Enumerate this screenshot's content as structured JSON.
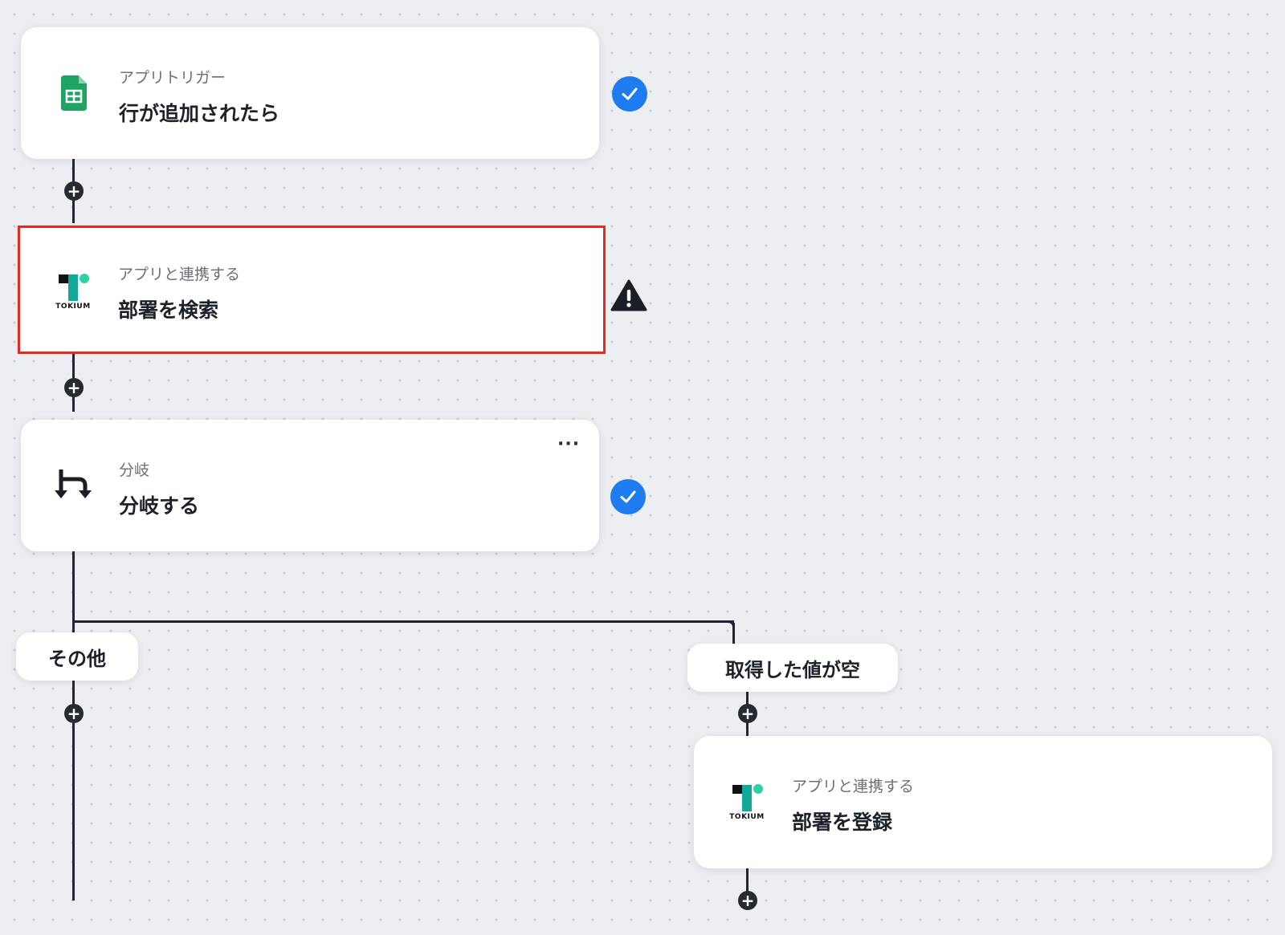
{
  "nodes": {
    "trigger": {
      "subtitle": "アプリトリガー",
      "title": "行が追加されたら",
      "icon": "google-sheets-icon",
      "status": "complete"
    },
    "search": {
      "subtitle": "アプリと連携する",
      "title": "部署を検索",
      "icon": "tokium-icon",
      "status": "warning"
    },
    "branch": {
      "subtitle": "分岐",
      "title": "分岐する",
      "icon": "branch-icon",
      "status": "complete"
    },
    "register": {
      "subtitle": "アプリと連携する",
      "title": "部署を登録",
      "icon": "tokium-icon"
    }
  },
  "branches": {
    "other_label": "その他",
    "empty_label": "取得した値が空"
  },
  "logo": {
    "tokium_text": "TOKIUM"
  },
  "colors": {
    "accent_blue": "#1f7cf0",
    "selection_red": "#e8291f",
    "sheets_green": "#1fa463",
    "tokium_teal": "#12a89a"
  }
}
